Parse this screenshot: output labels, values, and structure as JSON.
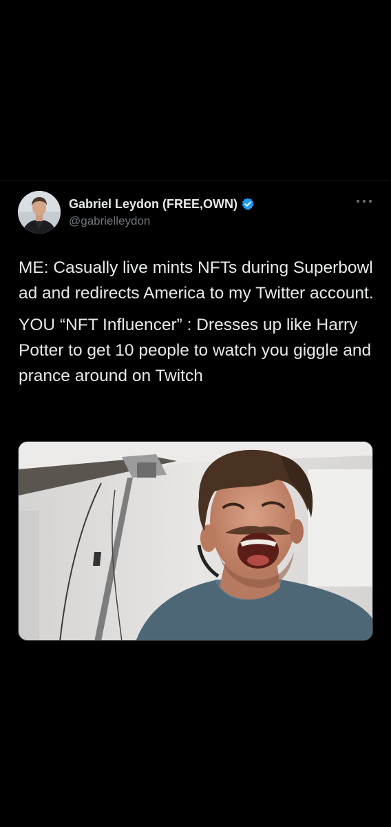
{
  "tweet": {
    "author": {
      "display_name": "Gabriel Leydon (FREE,OWN)",
      "handle": "@gabrielleydon",
      "verified": true,
      "avatar_icon": "profile-photo"
    },
    "paragraphs": [
      "ME: Casually live mints NFTs during Superbowl ad and redirects America to my Twitter account.",
      "YOU “NFT Influencer” : Dresses up like Harry Potter to get 10 people to watch you giggle and prance around on Twitch"
    ],
    "media": {
      "kind": "video-still",
      "icon": "laughing-man-photo"
    },
    "more_icon": "more-options-icon"
  },
  "colors": {
    "background": "#000000",
    "text": "#e7e9ea",
    "secondary_text": "#71767b",
    "verified_badge": "#1d9bf0"
  }
}
